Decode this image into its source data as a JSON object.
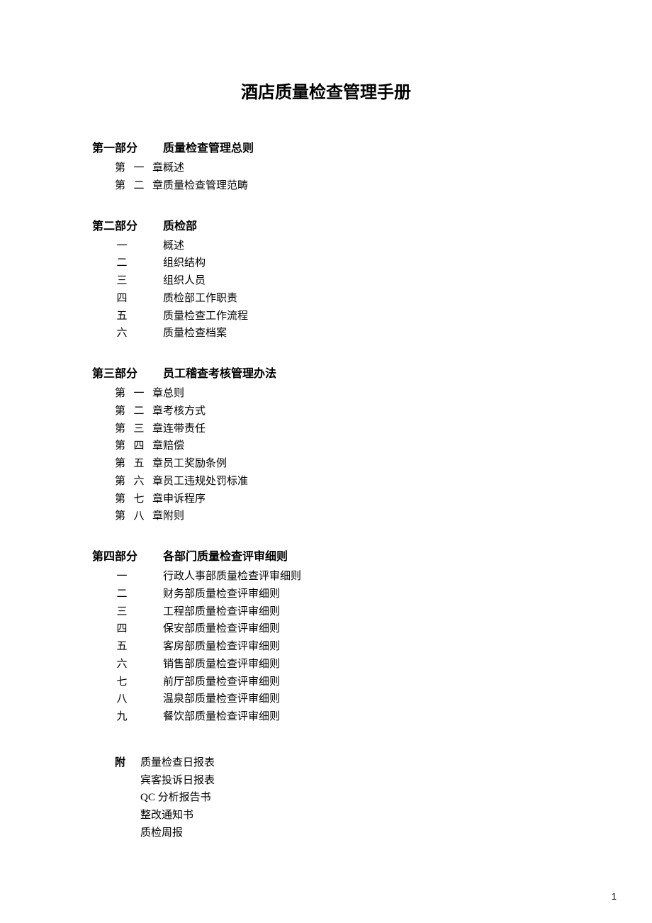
{
  "title": "酒店质量检查管理手册",
  "sections": [
    {
      "label": "第一部分",
      "title": "质量检查管理总则",
      "items": [
        {
          "label": "第一章",
          "text": "概述",
          "style": "chapter"
        },
        {
          "label": "第二章",
          "text": "质量检查管理范畴",
          "style": "chapter"
        }
      ]
    },
    {
      "label": "第二部分",
      "title": "质检部",
      "items": [
        {
          "label": "一",
          "text": "概述",
          "style": "num"
        },
        {
          "label": "二",
          "text": "组织结构",
          "style": "num"
        },
        {
          "label": "三",
          "text": "组织人员",
          "style": "num"
        },
        {
          "label": "四",
          "text": "质检部工作职责",
          "style": "num"
        },
        {
          "label": "五",
          "text": "质量检查工作流程",
          "style": "num"
        },
        {
          "label": "六",
          "text": "质量检查档案",
          "style": "num"
        }
      ]
    },
    {
      "label": "第三部分",
      "title": "员工稽查考核管理办法",
      "items": [
        {
          "label": "第一章",
          "text": "总则",
          "style": "chapter"
        },
        {
          "label": "第二章",
          "text": "考核方式",
          "style": "chapter"
        },
        {
          "label": "第三章",
          "text": "连带责任",
          "style": "chapter"
        },
        {
          "label": "第四章",
          "text": "赔偿",
          "style": "chapter"
        },
        {
          "label": "第五章",
          "text": "员工奖励条例",
          "style": "chapter"
        },
        {
          "label": "第六章",
          "text": "员工违规处罚标准",
          "style": "chapter"
        },
        {
          "label": "第七章",
          "text": "申诉程序",
          "style": "chapter"
        },
        {
          "label": "第八章",
          "text": "附则",
          "style": "chapter"
        }
      ]
    },
    {
      "label": "第四部分",
      "title": "各部门质量检查评审细则",
      "items": [
        {
          "label": "一",
          "text": "行政人事部质量检查评审细则",
          "style": "num"
        },
        {
          "label": "二",
          "text": "财务部质量检查评审细则",
          "style": "num"
        },
        {
          "label": "三",
          "text": "工程部质量检查评审细则",
          "style": "num"
        },
        {
          "label": "四",
          "text": "保安部质量检查评审细则",
          "style": "num"
        },
        {
          "label": "五",
          "text": "客房部质量检查评审细则",
          "style": "num"
        },
        {
          "label": "六",
          "text": "销售部质量检查评审细则",
          "style": "num"
        },
        {
          "label": "七",
          "text": "前厅部质量检查评审细则",
          "style": "num"
        },
        {
          "label": "八",
          "text": "温泉部质量检查评审细则",
          "style": "num"
        },
        {
          "label": "九",
          "text": "餐饮部质量检查评审细则",
          "style": "num"
        }
      ]
    }
  ],
  "appendix": {
    "label": "附",
    "items": [
      "质量检查日报表",
      "宾客投诉日报表",
      "QC 分析报告书",
      "整改通知书",
      "质检周报"
    ]
  },
  "pageNumber": "1"
}
